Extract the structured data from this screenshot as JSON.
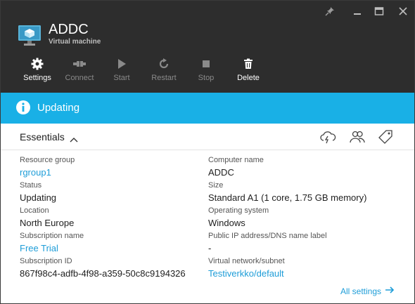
{
  "resource": {
    "title": "ADDC",
    "subtitle": "Virtual machine"
  },
  "commands": [
    {
      "label": "Settings",
      "icon": "gear-icon",
      "enabled": true
    },
    {
      "label": "Connect",
      "icon": "connect-plug-icon",
      "enabled": false
    },
    {
      "label": "Start",
      "icon": "play-icon",
      "enabled": false
    },
    {
      "label": "Restart",
      "icon": "restart-icon",
      "enabled": false
    },
    {
      "label": "Stop",
      "icon": "stop-square-icon",
      "enabled": false
    },
    {
      "label": "Delete",
      "icon": "trash-icon",
      "enabled": true
    }
  ],
  "status": {
    "text": "Updating",
    "color": "#19b0e6"
  },
  "essentials": {
    "title": "Essentials",
    "left": [
      {
        "key": "Resource group",
        "value": "rgroup1",
        "link": true
      },
      {
        "key": "Status",
        "value": "Updating",
        "link": false
      },
      {
        "key": "Location",
        "value": "North Europe",
        "link": false
      },
      {
        "key": "Subscription name",
        "value": "Free Trial",
        "link": true
      },
      {
        "key": "Subscription ID",
        "value": "867f98c4-adfb-4f98-a359-50c8c9194326",
        "link": false
      }
    ],
    "right": [
      {
        "key": "Computer name",
        "value": "ADDC",
        "link": false
      },
      {
        "key": "Size",
        "value": "Standard A1 (1 core, 1.75 GB memory)",
        "link": false
      },
      {
        "key": "Operating system",
        "value": "Windows",
        "link": false
      },
      {
        "key": "Public IP address/DNS name label",
        "value": "-",
        "link": false
      },
      {
        "key": "Virtual network/subnet",
        "value": "Testiverkko/default",
        "link": true
      }
    ],
    "all_settings": "All settings"
  },
  "colors": {
    "header_bg": "#2d2d2d",
    "accent": "#19b0e6",
    "link": "#1e9dd8"
  }
}
